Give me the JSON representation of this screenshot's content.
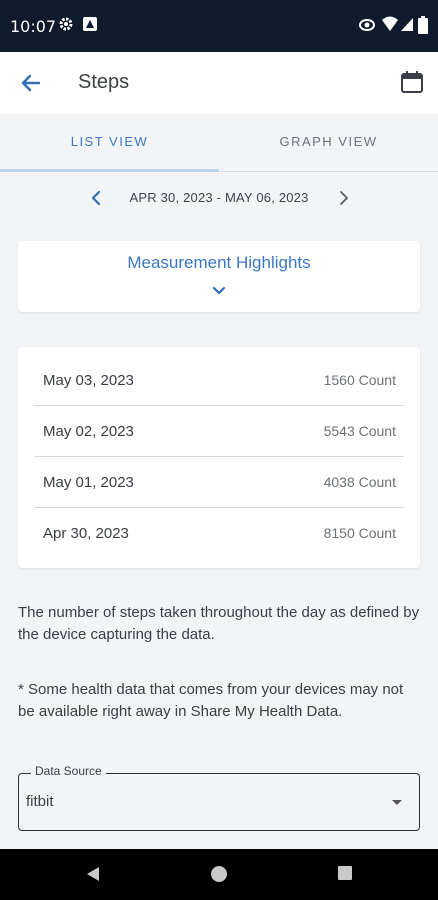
{
  "status_bar": {
    "time": "10:07"
  },
  "app_bar": {
    "title": "Steps"
  },
  "tabs": [
    {
      "label": "LIST VIEW",
      "selected": true
    },
    {
      "label": "GRAPH VIEW",
      "selected": false
    }
  ],
  "date_range": "APR 30, 2023 - MAY 06, 2023",
  "highlights": {
    "title": "Measurement Highlights"
  },
  "entries": [
    {
      "date": "May 03, 2023",
      "count": "1560 Count"
    },
    {
      "date": "May 02, 2023",
      "count": "5543 Count"
    },
    {
      "date": "May 01, 2023",
      "count": "4038 Count"
    },
    {
      "date": "Apr 30, 2023",
      "count": "8150 Count"
    }
  ],
  "description": "The number of steps taken throughout the day as defined by the device capturing the data.",
  "note": "* Some health data that comes from your devices may not be available right away in Share My Health Data.",
  "data_source": {
    "label": "Data Source",
    "value": "fitbit"
  },
  "colors": {
    "accent": "#3a78c3",
    "status_bar": "#0f1a2c",
    "background": "#f3f4f7"
  }
}
